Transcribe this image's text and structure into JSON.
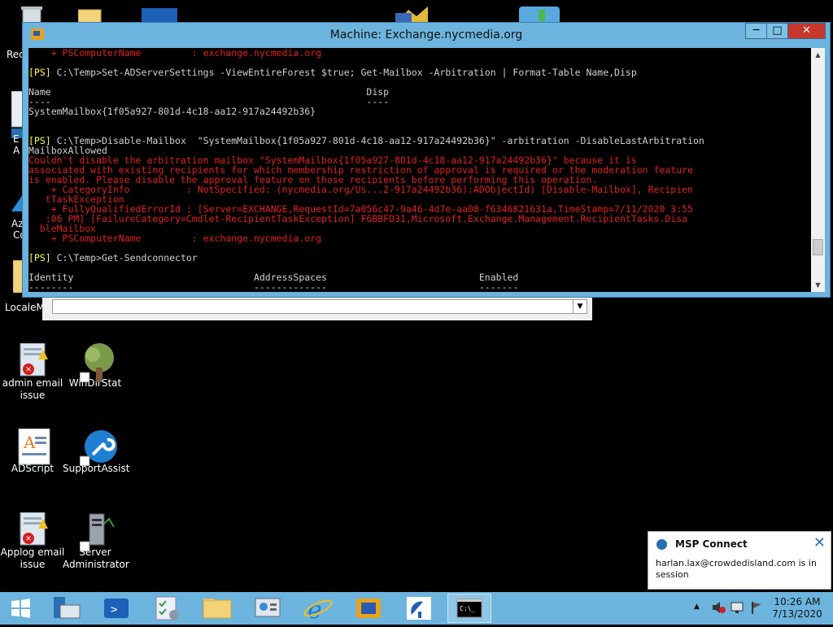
{
  "desktop": {
    "partial_labels": {
      "rec": "Rec",
      "az": "Az",
      "co": "Co",
      "localem": "LocaleM"
    },
    "icons": [
      {
        "name": "admin-email-issue",
        "label": "admin email issue",
        "icon": "document-error-icon"
      },
      {
        "name": "windirstat",
        "label": "WinDirStat",
        "icon": "tree-icon"
      },
      {
        "name": "adscript",
        "label": "ADScript",
        "icon": "text-document-icon"
      },
      {
        "name": "supportassist",
        "label": "SupportAssist",
        "icon": "wrench-icon"
      },
      {
        "name": "applog-email-issue",
        "label": "Applog email issue",
        "icon": "document-error-icon"
      },
      {
        "name": "server-administrator",
        "label": "Server Administrator",
        "icon": "server-icon"
      }
    ]
  },
  "window": {
    "title": "Machine: Exchange.nycmedia.org",
    "min_label": "─",
    "max_label": "□",
    "close_label": "✕",
    "console_lines": [
      {
        "c": "r",
        "t": "    + PSComputerName         : exchange.nycmedia.org"
      },
      {
        "c": "w",
        "t": ""
      },
      {
        "c": "yw",
        "p": "[PS]",
        "t": " C:\\Temp>Set-ADServerSettings -ViewEntireForest $true; Get-Mailbox -Arbitration | Format-Table Name,Disp"
      },
      {
        "c": "w",
        "t": ""
      },
      {
        "c": "w",
        "t": "Name                                                        Disp"
      },
      {
        "c": "w",
        "t": "----                                                        ----"
      },
      {
        "c": "w",
        "t": "SystemMailbox{1f05a927-801d-4c18-aa12-917a24492b36}"
      },
      {
        "c": "w",
        "t": ""
      },
      {
        "c": "w",
        "t": ""
      },
      {
        "c": "yw",
        "p": "[PS]",
        "t": " C:\\Temp>Disable-Mailbox  \"SystemMailbox{1f05a927-801d-4c18-aa12-917a24492b36}\" -arbitration -DisableLastArbitration"
      },
      {
        "c": "w",
        "t": "MailboxAllowed"
      },
      {
        "c": "r",
        "t": "Couldn't disable the arbitration mailbox \"SystemMailbox{1f05a927-801d-4c18-aa12-917a24492b36}\" because it is"
      },
      {
        "c": "r",
        "t": "associated with existing recipients for which membership restriction of approval is required or the moderation feature"
      },
      {
        "c": "r",
        "t": "is enabled. Please disable the approval feature on those recipients before performing this operation."
      },
      {
        "c": "r",
        "t": "    + CategoryInfo          : NotSpecified: (nycmedia.org/Us...2-917a24492b36):ADObjectId) [Disable-Mailbox], Recipien"
      },
      {
        "c": "r",
        "t": "   tTaskException"
      },
      {
        "c": "r",
        "t": "    + FullyQualifiedErrorId : [Server=EXCHANGE,RequestId=7a056c47-9a46-4d7e-aa08-f6346821631a,TimeStamp=7/11/2020 3:55"
      },
      {
        "c": "r",
        "t": "   :06 PM] [FailureCategory=Cmdlet-RecipientTaskException] F6BBFD31,Microsoft.Exchange.Management.RecipientTasks.Disa"
      },
      {
        "c": "r",
        "t": "  bleMailbox"
      },
      {
        "c": "r",
        "t": "    + PSComputerName         : exchange.nycmedia.org"
      },
      {
        "c": "w",
        "t": ""
      },
      {
        "c": "yw",
        "p": "[PS]",
        "t": " C:\\Temp>Get-Sendconnector"
      },
      {
        "c": "w",
        "t": ""
      },
      {
        "c": "w",
        "t": "Identity                                AddressSpaces                           Enabled"
      },
      {
        "c": "w",
        "t": "--------                                -------------                           -------"
      }
    ]
  },
  "taskbar": {
    "buttons": [
      {
        "name": "start-button",
        "icon": "windows-logo-icon"
      },
      {
        "name": "file-explorer-taskbar",
        "icon": "server-manager-icon"
      },
      {
        "name": "powershell-taskbar",
        "icon": "powershell-icon"
      },
      {
        "name": "checklist-taskbar",
        "icon": "checklist-icon"
      },
      {
        "name": "folder-taskbar",
        "icon": "folder-icon"
      },
      {
        "name": "control-panel-taskbar",
        "icon": "control-panel-icon"
      },
      {
        "name": "internet-explorer-taskbar",
        "icon": "internet-explorer-icon"
      },
      {
        "name": "exchange-taskbar",
        "icon": "exchange-icon"
      },
      {
        "name": "remote-taskbar",
        "icon": "satellite-dish-icon"
      },
      {
        "name": "cmd-taskbar",
        "icon": "command-prompt-icon"
      }
    ],
    "clock_time": "10:26 AM",
    "clock_date": "7/13/2020",
    "tray_up_arrow": "▲"
  },
  "notification": {
    "title": "MSP Connect",
    "message": "harlan.lax@crowdedisland.com is in session",
    "close": "✕"
  },
  "colors": {
    "accent": "#6cb4de",
    "ps_prompt": "#ffff55",
    "error": "#e02020",
    "close_button": "#c7372b"
  }
}
